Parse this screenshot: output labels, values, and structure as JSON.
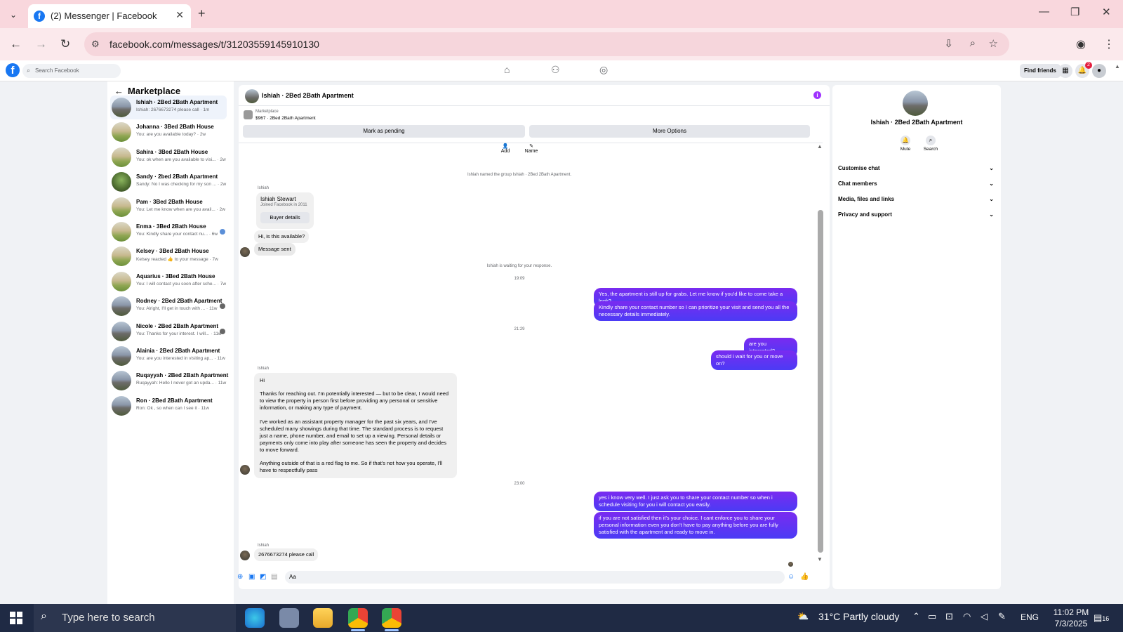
{
  "browser": {
    "tab_title": "(2) Messenger | Facebook",
    "url": "facebook.com/messages/t/31203559145910130"
  },
  "facebook": {
    "search_placeholder": "Search Facebook",
    "find_friends": "Find friends",
    "notification_count": "2"
  },
  "left": {
    "header": "Marketplace",
    "conversations": [
      {
        "name": "Ishiah · 2Bed 2Bath Apartment",
        "preview": "Ishiah: 2676673274 please call · 1m",
        "avatar": "building"
      },
      {
        "name": "Johanna · 3Bed 2Bath House",
        "preview": "You: are you available today? · 2w",
        "avatar": "house"
      },
      {
        "name": "Sahira · 3Bed 2Bath House",
        "preview": "You: ok when are you available to visi... · 2w",
        "avatar": "house"
      },
      {
        "name": "Sandy · 2bed 2Bath Apartment",
        "preview": "Sandy: No I was checking for my son ... · 2w",
        "avatar": "green"
      },
      {
        "name": "Pam · 3Bed 2Bath House",
        "preview": "You: Let me know when are you avail... · 2w",
        "avatar": "house"
      },
      {
        "name": "Enma · 3Bed 2Bath House",
        "preview": "You: Kindly share your contact nu... · 6w",
        "avatar": "house"
      },
      {
        "name": "Kelsey · 3Bed 2Bath House",
        "preview": "Kelsey reacted 👍 to your message · 7w",
        "avatar": "house"
      },
      {
        "name": "Aquarius · 3Bed 2Bath House",
        "preview": "You: I will contact you soon after sche... · 7w",
        "avatar": "house"
      },
      {
        "name": "Rodney · 2Bed 2Bath Apartment",
        "preview": "You: Alright, I'll get in touch with ... · 11w",
        "avatar": "building"
      },
      {
        "name": "Nicole · 2Bed 2Bath Apartment",
        "preview": "You: Thanks for your interest. I will... · 11w",
        "avatar": "building"
      },
      {
        "name": "Alainia · 2Bed 2Bath Apartment",
        "preview": "You: are you interested in visiting ap... · 11w",
        "avatar": "building"
      },
      {
        "name": "Ruqayyah · 2Bed 2Bath Apartment",
        "preview": "Ruqayyah: Hello I never got an upda... · 11w",
        "avatar": "building"
      },
      {
        "name": "Ron · 2Bed 2Bath Apartment",
        "preview": "Ron: Ok , so when can I see it · 11w",
        "avatar": "building"
      }
    ]
  },
  "chat": {
    "title": "Ishiah · 2Bed 2Bath Apartment",
    "marketplace_label": "Marketplace",
    "listing": "$967 · 2Bed 2Bath Apartment",
    "mark_pending": "Mark as pending",
    "more_options": "More Options",
    "add_label": "Add",
    "name_label": "Name",
    "system_named": "Ishiah named the group Ishiah · 2Bed 2Bath Apartment.",
    "sender": "Ishiah",
    "buyer_name": "Ishiah Stewart",
    "buyer_joined": "Joined Facebook in 2011",
    "buyer_details": "Buyer details",
    "msg_available": "Hi, is this available?",
    "msg_sent": "Message sent",
    "waiting": "Ishiah is waiting for your response.",
    "time1": "19:09",
    "out1": "Yes, the apartment is still up for grabs. Let me know if you'd like to come take a look?",
    "out2": "Kindly share your contact number so I can prioritize your visit and send you all the necessary details immediately.",
    "time2": "21:29",
    "out3": "are you interested?",
    "out4": "should i wait for you or move on?",
    "in_hi": "Hi",
    "in_p1": "Thanks for reaching out. I'm potentially interested — but to be clear, I would need to view the property in person first before providing any personal or sensitive information, or making any type of payment.",
    "in_p2": "I've worked as an assistant property manager for the past six years, and I've scheduled many showings during that time. The standard process is to request just a name, phone number, and email to set up a viewing. Personal details or payments only come into play after someone has seen the property and decides to move forward.",
    "in_p3": "Anything outside of that is a red flag to me. So if that's not how you operate, I'll have to respectfully pass",
    "time3": "23:00",
    "out5": "yes i know very well. I just ask you to share your contact number so when i schedule visiting for you i will contact you easily.",
    "out6": "if you are not satisfied then it's your choice. I cant enforce you to share your personal information even you don't have to pay anything before you are fully satisfied with the apartment and ready to move in.",
    "last_in": "2676673274 please call",
    "composer_value": "Aa"
  },
  "right": {
    "title": "Ishiah · 2Bed 2Bath Apartment",
    "mute": "Mute",
    "search": "Search",
    "rows": [
      "Customise chat",
      "Chat members",
      "Media, files and links",
      "Privacy and support"
    ]
  },
  "taskbar": {
    "search_placeholder": "Type here to search",
    "weather": "31°C  Partly cloudy",
    "lang": "ENG",
    "time": "11:02 PM",
    "date": "7/3/2025",
    "notif_count": "16"
  }
}
